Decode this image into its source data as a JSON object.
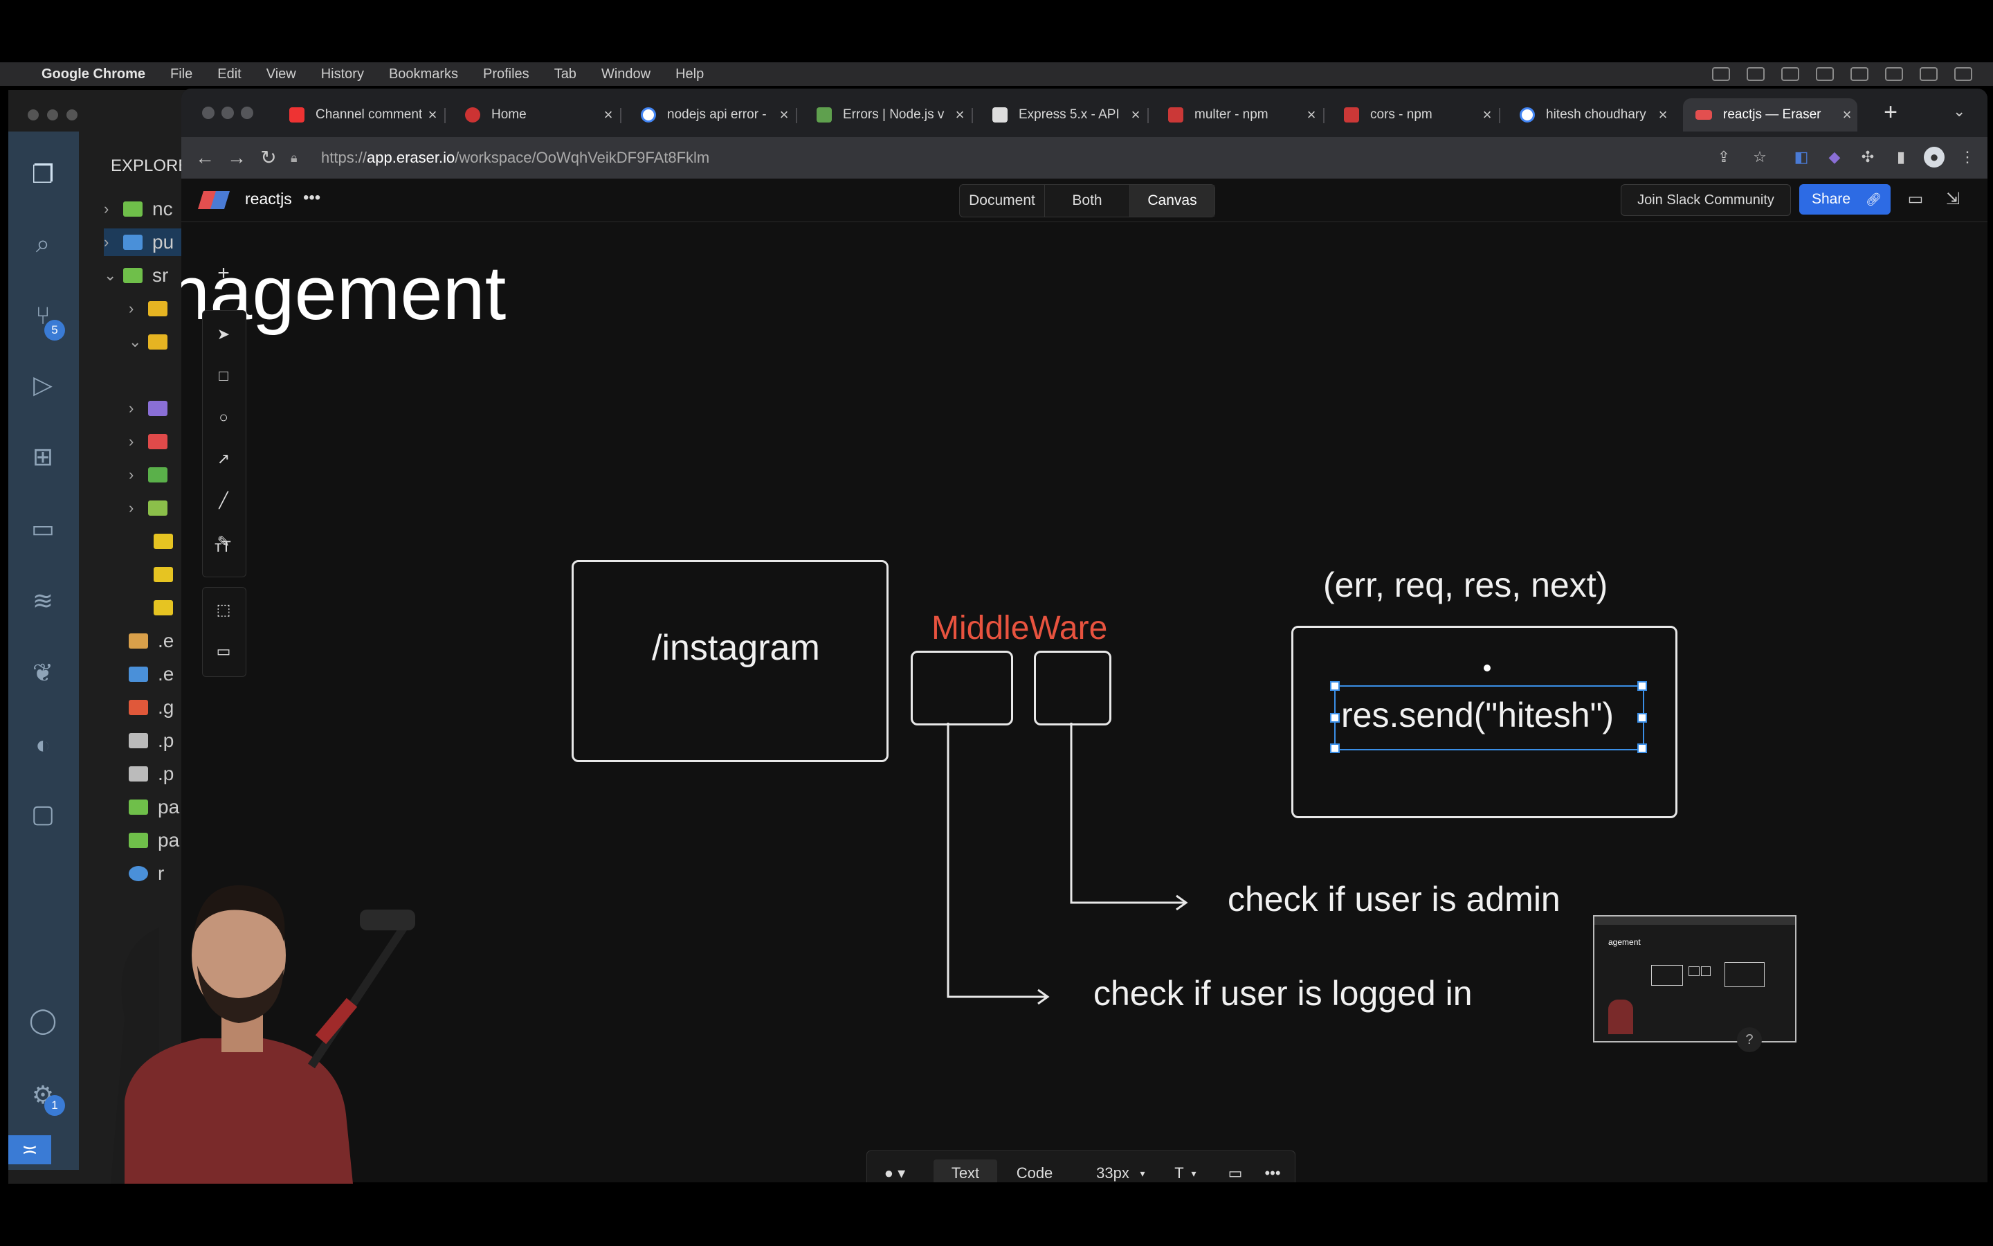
{
  "menubar": {
    "app": "Google Chrome",
    "items": [
      "File",
      "Edit",
      "View",
      "History",
      "Bookmarks",
      "Profiles",
      "Tab",
      "Window",
      "Help"
    ]
  },
  "vscode": {
    "explorer_title": "EXPLORE",
    "source_control_badge": "5",
    "settings_badge": "1",
    "tree": [
      {
        "label": "nc"
      },
      {
        "label": "pu"
      },
      {
        "label": "sr"
      },
      {
        "label": ""
      },
      {
        "label": ""
      },
      {
        "label": ""
      },
      {
        "label": ""
      },
      {
        "label": ""
      },
      {
        "label": ""
      },
      {
        "label": ""
      },
      {
        "label": ""
      },
      {
        "label": ""
      },
      {
        "label": ".e"
      },
      {
        "label": ".e"
      },
      {
        "label": ".g"
      },
      {
        "label": ".p"
      },
      {
        "label": ".p"
      },
      {
        "label": "pa"
      },
      {
        "label": "pa"
      },
      {
        "label": "r"
      }
    ]
  },
  "chrome": {
    "tabs": [
      {
        "label": "Channel comment",
        "color": "#e33"
      },
      {
        "label": "Home",
        "color": "#c33"
      },
      {
        "label": "nodejs api error -",
        "color": "#4285f4"
      },
      {
        "label": "Errors | Node.js v",
        "color": "#5fa04e"
      },
      {
        "label": "Express 5.x - API",
        "color": "#888888"
      },
      {
        "label": "multer - npm",
        "color": "#cb3837"
      },
      {
        "label": "cors - npm",
        "color": "#cb3837"
      },
      {
        "label": "hitesh choudhary",
        "color": "#4285f4"
      },
      {
        "label": "reactjs — Eraser",
        "color": "#e34f4f"
      }
    ],
    "url_prefix": "https://",
    "url_host": "app.eraser.io",
    "url_path": "/workspace/OoWqhVeikDF9FAt8Fklm"
  },
  "eraser": {
    "file_name": "reactjs",
    "modes": [
      "Document",
      "Both",
      "Canvas"
    ],
    "active_mode": "Canvas",
    "join_slack": "Join Slack Community",
    "share": "Share"
  },
  "canvas": {
    "heading": "nagement",
    "instagram_label": "/instagram",
    "middleware_label": "MiddleWare",
    "signature_label": "(err, req, res, next)",
    "res_send_label": "res.send(\"hitesh\")",
    "admin_label": "check if user is admin",
    "logged_in_label": "check if user is logged in",
    "middleware_color": "#e8533f"
  },
  "bottom_toolbar": {
    "text_btn": "Text",
    "code_btn": "Code",
    "font_size": "33px",
    "font_btn": "T",
    "more": "•••"
  },
  "minimap": {
    "label": "agement"
  },
  "help": "?"
}
